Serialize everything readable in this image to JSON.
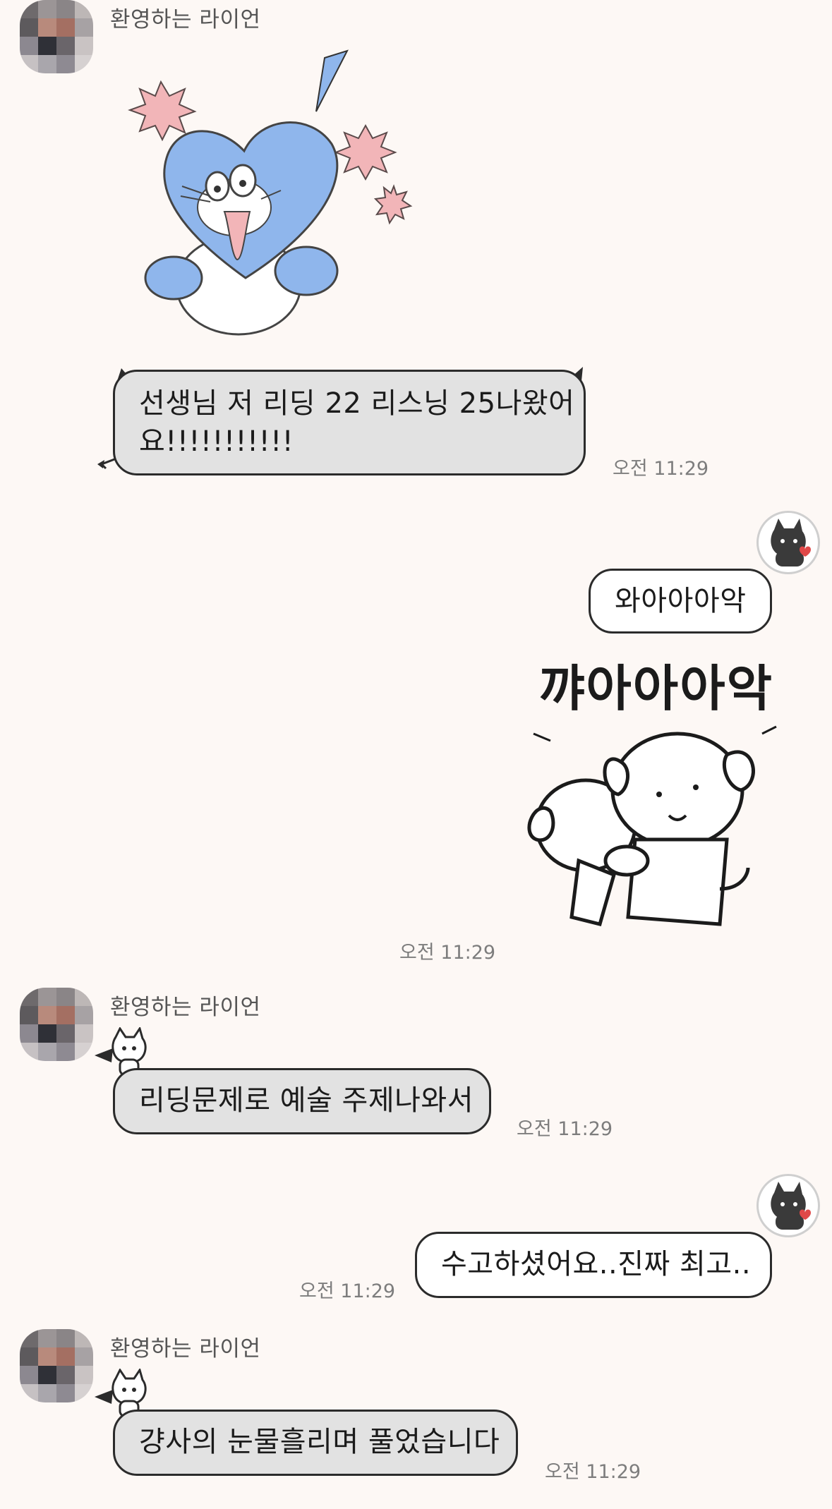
{
  "messages": [
    {
      "sender": "환영하는 라이언",
      "type": "sticker",
      "sticker": "blue-heart-shocked-sticker"
    },
    {
      "sender": "환영하는 라이언",
      "type": "text",
      "lines": [
        "선생님 저 리딩 22 리스닝 25나왔어",
        "요!!!!!!!!!!!"
      ],
      "time": "오전 11:29"
    },
    {
      "sender": "me",
      "type": "text",
      "text": "와아아아악",
      "time": ""
    },
    {
      "sender": "me",
      "type": "sticker",
      "sticker_text": "꺄아아아악",
      "time": "오전 11:29"
    },
    {
      "sender": "환영하는 라이언",
      "type": "text",
      "text": "리딩문제로 예술 주제나와서",
      "time": "오전 11:29"
    },
    {
      "sender": "me",
      "type": "text",
      "text": "수고하셨어요..진짜 최고..",
      "time": "오전 11:29"
    },
    {
      "sender": "환영하는 라이언",
      "type": "text",
      "text": "걍사의 눈물흘리며 풀었습니다",
      "time": "오전 11:29"
    }
  ],
  "icons": {
    "friend_avatar": "pixelated-avatar-icon",
    "my_avatar": "black-cat-avatar-icon",
    "bubble_decoration": "white-cat-devil-icon"
  },
  "colors": {
    "background": "#fdf8f5",
    "incoming_bubble": "#e2e2e2",
    "outgoing_bubble": "#ffffff",
    "bubble_border": "#2b2b2b",
    "sticker_blue": "#8fb6ec",
    "sticker_pink": "#f2b5b8"
  }
}
